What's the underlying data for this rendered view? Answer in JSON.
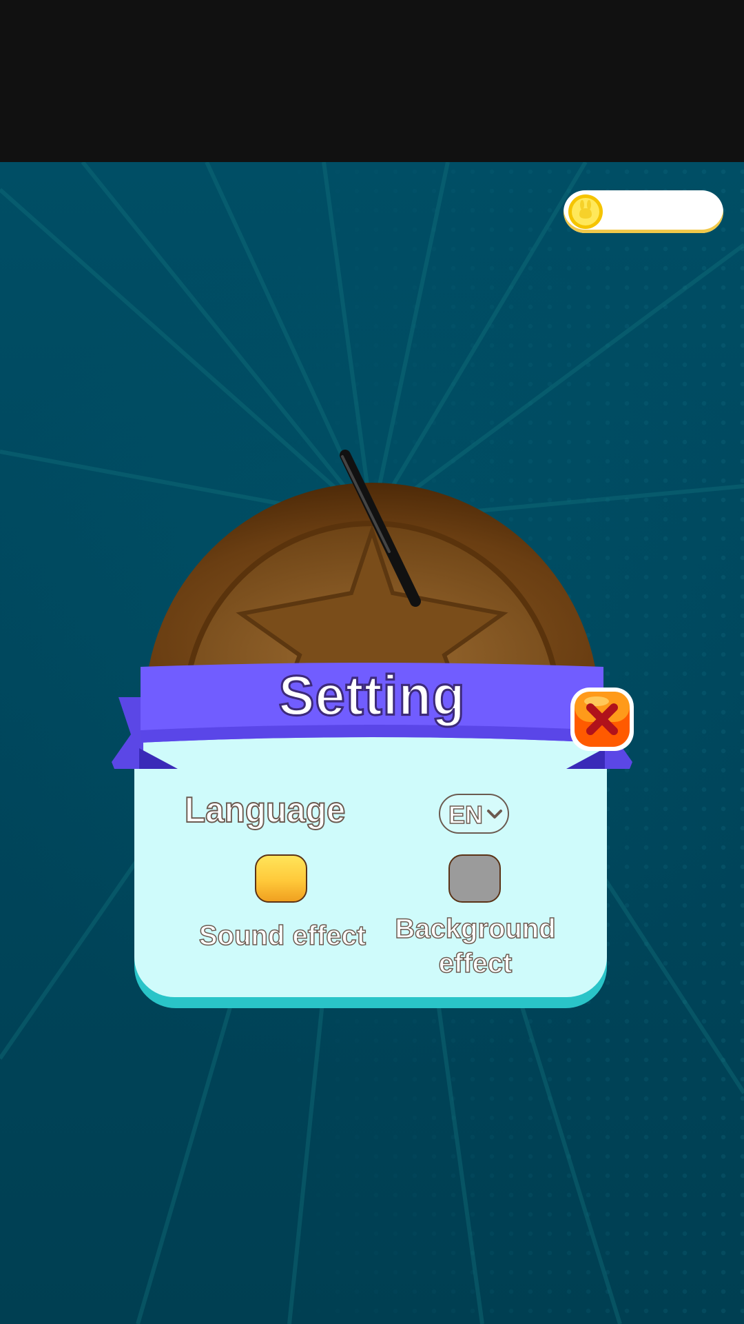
{
  "hud": {
    "coin_icon": "coin-bunny-icon",
    "coin_value": ""
  },
  "dialog": {
    "title": "Setting",
    "close_icon": "close-x-icon",
    "language": {
      "label": "Language",
      "selected": "EN",
      "icon": "chevron-down-icon"
    },
    "toggles": [
      {
        "label": "Sound effect",
        "state": "on"
      },
      {
        "label": "Background effect",
        "state": "off"
      }
    ]
  },
  "colors": {
    "ribbon": "#6f5cf5",
    "panel": "#cffbfb",
    "panel_edge": "#2ac4c8",
    "close_button": "#ff6a00",
    "toggle_on": "#ffc93a",
    "toggle_off": "#9b9b9b",
    "background": "#004a60"
  }
}
